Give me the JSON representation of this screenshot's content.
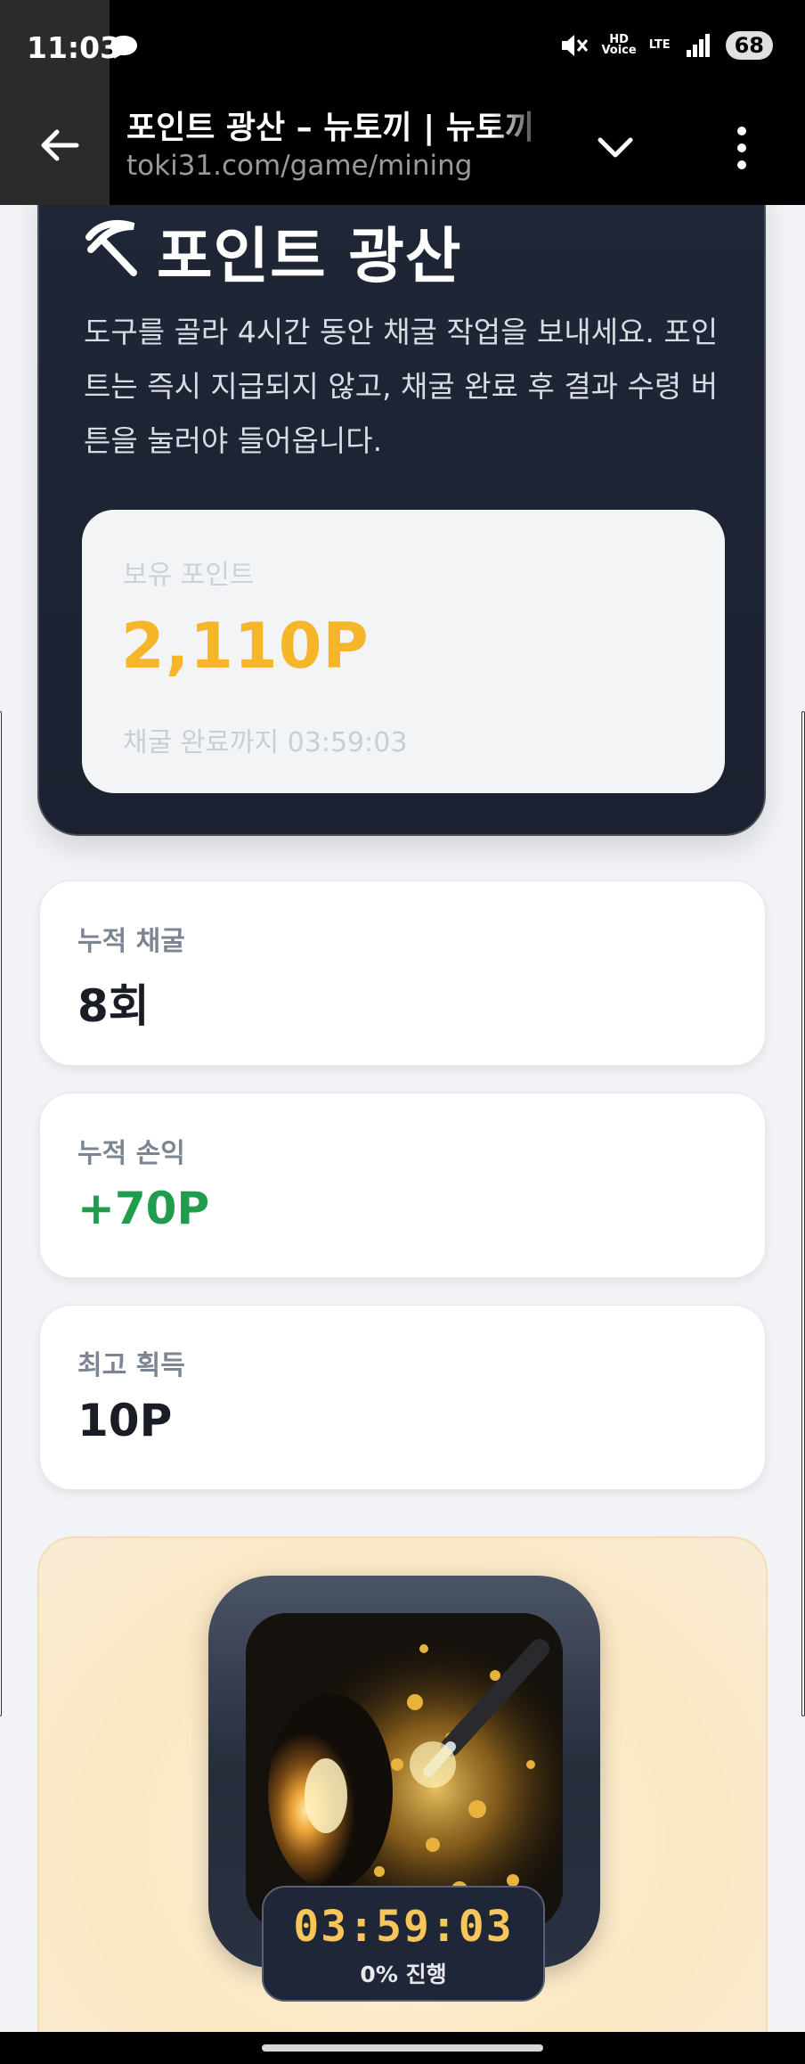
{
  "status_bar": {
    "time": "11:03",
    "voice_label": "HD\nVoice",
    "network_label": "LTE",
    "battery": "68"
  },
  "browser": {
    "page_title": "포인트 광산 – 뉴토끼 | 뉴토끼",
    "url": "toki31.com/game/mining"
  },
  "hero": {
    "title": "포인트 광산",
    "description": "도구를 골라 4시간 동안 채굴 작업을 보내세요. 포인트는 즉시 지급되지 않고, 채굴 완료 후 결과 수령 버튼을 눌러야 들어옵니다.",
    "balance_label": "보유 포인트",
    "balance_value": "2,110P",
    "until_complete": "채굴 완료까지 03:59:03"
  },
  "stats": [
    {
      "label": "누적 채굴",
      "value": "8회"
    },
    {
      "label": "누적 손익",
      "value": "+70P"
    },
    {
      "label": "최고 획득",
      "value": "10P"
    }
  ],
  "mining": {
    "timer": "03:59:03",
    "progress_text": "0% 진행",
    "progress": 0
  },
  "colors": {
    "accent_gold": "#f5b62a",
    "profit_green": "#1f9d4c",
    "hero_dark": "#1f2636"
  }
}
